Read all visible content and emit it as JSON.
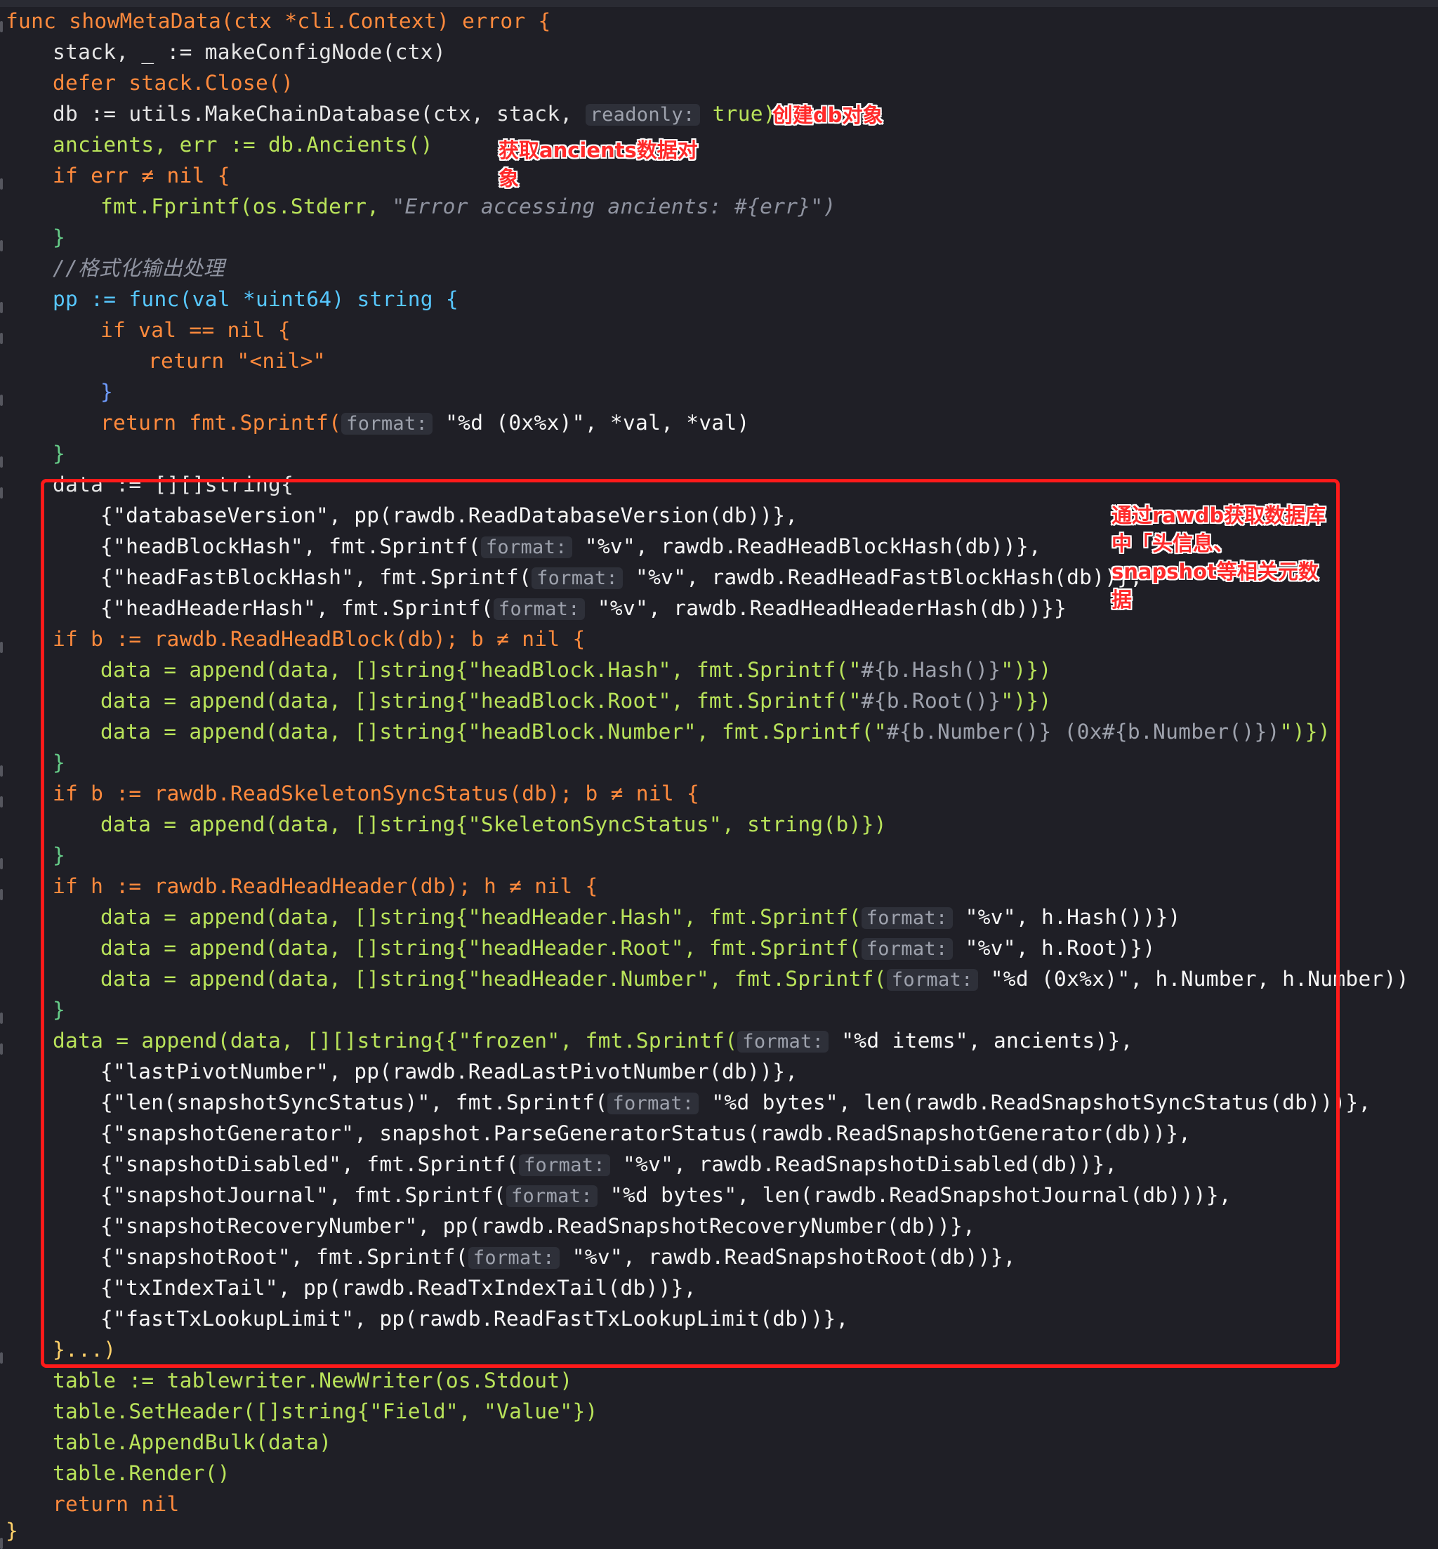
{
  "code": {
    "l1": "func showMetaData(ctx *cli.Context) error {",
    "l2": "stack, _ := makeConfigNode(ctx)",
    "l3": "defer stack.Close()",
    "l4a": "db := utils.MakeChainDatabase(ctx, stack, ",
    "l4hint": "readonly:",
    "l4b": " true)",
    "l5": "ancients, err := db.Ancients()",
    "l6": "if err ≠ nil {",
    "l7a": "fmt.Fprintf(os.Stderr, ",
    "l7b": "\"Error accessing ancients: #{err}\")",
    "l8": "}",
    "l9": "//格式化输出处理",
    "l10": "pp := func(val *uint64) string {",
    "l11": "if val == nil {",
    "l12": "return \"<nil>\"",
    "l13": "}",
    "l14a": "return fmt.Sprintf(",
    "l14hint": "format:",
    "l14b": " \"%d (0x%x)\", *val, *val)",
    "l15": "}",
    "l16": "data := [][]string{",
    "l17": "{\"databaseVersion\", pp(rawdb.ReadDatabaseVersion(db))},",
    "l18a": "{\"headBlockHash\", fmt.Sprintf(",
    "l18hint": "format:",
    "l18b": " \"%v\", rawdb.ReadHeadBlockHash(db))},",
    "l19a": "{\"headFastBlockHash\", fmt.Sprintf(",
    "l19hint": "format:",
    "l19b": " \"%v\", rawdb.ReadHeadFastBlockHash(db))},",
    "l20a": "{\"headHeaderHash\", fmt.Sprintf(",
    "l20hint": "format:",
    "l20b": " \"%v\", rawdb.ReadHeadHeaderHash(db))}}",
    "l21": "if b := rawdb.ReadHeadBlock(db); b ≠ nil {",
    "l22a": "data = append(data, []string{\"headBlock.Hash\", fmt.Sprintf(\"",
    "l22b": "#{b.Hash()}",
    "l22c": "\")})",
    "l23a": "data = append(data, []string{\"headBlock.Root\", fmt.Sprintf(\"",
    "l23b": "#{b.Root()}",
    "l23c": "\")})",
    "l24a": "data = append(data, []string{\"headBlock.Number\", fmt.Sprintf(\"",
    "l24b": "#{b.Number()} (0x#{b.Number()})",
    "l24c": "\")})",
    "l25": "}",
    "l26": "if b := rawdb.ReadSkeletonSyncStatus(db); b ≠ nil {",
    "l27": "data = append(data, []string{\"SkeletonSyncStatus\", string(b)})",
    "l28": "}",
    "l29": "if h := rawdb.ReadHeadHeader(db); h ≠ nil {",
    "l30a": "data = append(data, []string{\"headHeader.Hash\", fmt.Sprintf(",
    "l30hint": "format:",
    "l30b": " \"%v\", h.Hash())})",
    "l31a": "data = append(data, []string{\"headHeader.Root\", fmt.Sprintf(",
    "l31hint": "format:",
    "l31b": " \"%v\", h.Root)})",
    "l32a": "data = append(data, []string{\"headHeader.Number\", fmt.Sprintf(",
    "l32hint": "format:",
    "l32b": " \"%d (0x%x)\", h.Number, h.Number))",
    "l33": "}",
    "l34a": "data = append(data, [][]string{{\"frozen\", fmt.Sprintf(",
    "l34hint": "format:",
    "l34b": " \"%d items\", ancients)},",
    "l35": "{\"lastPivotNumber\", pp(rawdb.ReadLastPivotNumber(db))},",
    "l36a": "{\"len(snapshotSyncStatus)\", fmt.Sprintf(",
    "l36hint": "format:",
    "l36b": " \"%d bytes\", len(rawdb.ReadSnapshotSyncStatus(db)))},",
    "l37": "{\"snapshotGenerator\", snapshot.ParseGeneratorStatus(rawdb.ReadSnapshotGenerator(db))},",
    "l38a": "{\"snapshotDisabled\", fmt.Sprintf(",
    "l38hint": "format:",
    "l38b": " \"%v\", rawdb.ReadSnapshotDisabled(db))},",
    "l39a": "{\"snapshotJournal\", fmt.Sprintf(",
    "l39hint": "format:",
    "l39b": " \"%d bytes\", len(rawdb.ReadSnapshotJournal(db)))},",
    "l40": "{\"snapshotRecoveryNumber\", pp(rawdb.ReadSnapshotRecoveryNumber(db))},",
    "l41a": "{\"snapshotRoot\", fmt.Sprintf(",
    "l41hint": "format:",
    "l41b": " \"%v\", rawdb.ReadSnapshotRoot(db))},",
    "l42": "{\"txIndexTail\", pp(rawdb.ReadTxIndexTail(db))},",
    "l43": "{\"fastTxLookupLimit\", pp(rawdb.ReadFastTxLookupLimit(db))},",
    "l44": "}...)",
    "l45": "table := tablewriter.NewWriter(os.Stdout)",
    "l46": "table.SetHeader([]string{\"Field\", \"Value\"})",
    "l47": "table.AppendBulk(data)",
    "l48": "table.Render()",
    "l49": "return nil",
    "l50": "}"
  },
  "annotations": {
    "a1": "创建db对象",
    "a2": "获取ancients数据对\n象",
    "a3": "通过rawdb获取数据库\n中「头信息、\nsnapshot等相关元数\n据"
  },
  "colors": {
    "background": "#1f1f26",
    "highlight_box": "#ff1a1a",
    "annotation_text": "#ff2a2a"
  }
}
